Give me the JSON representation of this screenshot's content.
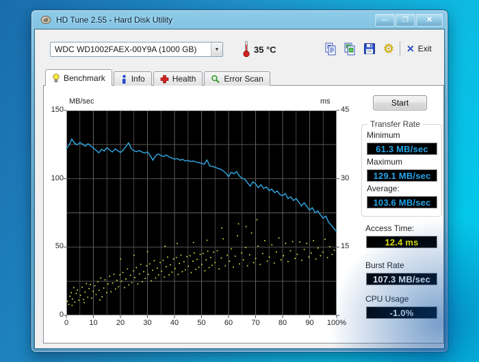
{
  "window": {
    "title": "HD Tune 2.55 - Hard Disk Utility",
    "minimize_glyph": "—",
    "maximize_glyph": "❐",
    "close_glyph": "✕"
  },
  "toolbar": {
    "drive": "WDC WD1002FAEX-00Y9A (1000 GB)",
    "dropdown_arrow": "▼",
    "temperature": "35 °C",
    "options_glyph": "⚙",
    "exit_glyph": "✕",
    "exit_label": "Exit"
  },
  "tabs": [
    {
      "label": "Benchmark",
      "active": true
    },
    {
      "label": "Info",
      "active": false
    },
    {
      "label": "Health",
      "active": false
    },
    {
      "label": "Error Scan",
      "active": false
    }
  ],
  "panel": {
    "start_label": "Start",
    "transfer_rate": {
      "title": "Transfer Rate",
      "minimum_label": "Minimum",
      "minimum_value": "61.3 MB/sec",
      "maximum_label": "Maximum",
      "maximum_value": "129.1 MB/sec",
      "average_label": "Average:",
      "average_value": "103.6 MB/sec"
    },
    "access_time_label": "Access Time:",
    "access_time_value": "12.4 ms",
    "burst_rate_label": "Burst Rate",
    "burst_rate_value": "107.3 MB/sec",
    "cpu_usage_label": "CPU Usage",
    "cpu_usage_value": "-1.0%"
  },
  "colors": {
    "transfer_line": "#2da2da",
    "access_dots": "#d6e23e",
    "value_cyan": "#25a5e8",
    "value_yellow": "#e8e400",
    "grid": "#616161",
    "plot_bg": "#000000"
  },
  "chart_data": {
    "type": "line",
    "title": "HD Tune benchmark: transfer rate line (MB/sec, left axis) with access time scatter (ms, right axis) vs disk position (%)",
    "left_axis": {
      "label": "MB/sec",
      "range": [
        0,
        150
      ],
      "tick_labels": [
        "150",
        "100",
        "50",
        "0"
      ]
    },
    "right_axis": {
      "label": "ms",
      "range": [
        0,
        45
      ],
      "tick_labels": [
        "45",
        "30",
        "15"
      ]
    },
    "x_axis": {
      "range": [
        0,
        100
      ],
      "tick_labels": [
        "0",
        "10",
        "20",
        "30",
        "40",
        "50",
        "60",
        "70",
        "80",
        "90",
        "100%"
      ]
    },
    "grid": {
      "vertical_step_pct": 5,
      "horizontal_step_mbsec": 25
    },
    "series": [
      {
        "name": "transfer_rate",
        "kind": "line",
        "color": "#2da2da",
        "y_unit": "MB/sec",
        "min": 61.3,
        "max": 129.1,
        "average": 103.6,
        "points": [
          [
            0,
            122
          ],
          [
            1,
            124.5
          ],
          [
            2,
            129.1
          ],
          [
            3,
            126
          ],
          [
            4,
            124.8
          ],
          [
            5,
            126.5
          ],
          [
            6,
            125.2
          ],
          [
            7,
            123.8
          ],
          [
            8,
            125.6
          ],
          [
            9,
            124
          ],
          [
            10,
            122.5
          ],
          [
            11,
            120.8
          ],
          [
            12,
            118.9
          ],
          [
            13,
            121.5
          ],
          [
            14,
            120.2
          ],
          [
            15,
            122.8
          ],
          [
            16,
            121
          ],
          [
            17,
            119.5
          ],
          [
            18,
            121.8
          ],
          [
            19,
            120.5
          ],
          [
            20,
            119.2
          ],
          [
            21,
            121
          ],
          [
            22,
            123.5
          ],
          [
            23,
            126.3
          ],
          [
            24,
            122
          ],
          [
            25,
            120.4
          ],
          [
            26,
            119.8
          ],
          [
            27,
            120.6
          ],
          [
            28,
            119.5
          ],
          [
            29,
            118.8
          ],
          [
            30,
            119.6
          ],
          [
            31,
            117
          ],
          [
            32,
            113.5
          ],
          [
            33,
            116.8
          ],
          [
            34,
            118.2
          ],
          [
            35,
            117
          ],
          [
            36,
            116.2
          ],
          [
            37,
            117.4
          ],
          [
            38,
            116
          ],
          [
            39,
            115.2
          ],
          [
            40,
            114.4
          ],
          [
            41,
            114.8
          ],
          [
            42,
            113.6
          ],
          [
            43,
            114.2
          ],
          [
            44,
            113
          ],
          [
            45,
            113.4
          ],
          [
            46,
            112.6
          ],
          [
            47,
            113
          ],
          [
            48,
            112.2
          ],
          [
            49,
            111.8
          ],
          [
            50,
            111.2
          ],
          [
            51,
            110.6
          ],
          [
            52,
            113.8
          ],
          [
            53,
            109.4
          ],
          [
            54,
            109
          ],
          [
            55,
            108.4
          ],
          [
            56,
            107.6
          ],
          [
            57,
            107
          ],
          [
            58,
            105.8
          ],
          [
            59,
            104.2
          ],
          [
            60,
            101.5
          ],
          [
            61,
            104.8
          ],
          [
            62,
            103.6
          ],
          [
            63,
            105.2
          ],
          [
            64,
            102
          ],
          [
            65,
            100.4
          ],
          [
            66,
            99.6
          ],
          [
            67,
            97
          ],
          [
            68,
            94.5
          ],
          [
            69,
            97.8
          ],
          [
            70,
            96.2
          ],
          [
            71,
            93.4
          ],
          [
            72,
            95.6
          ],
          [
            73,
            92.8
          ],
          [
            74,
            94
          ],
          [
            75,
            91.2
          ],
          [
            76,
            92.4
          ],
          [
            77,
            89.8
          ],
          [
            78,
            91
          ],
          [
            79,
            88.4
          ],
          [
            80,
            87.6
          ],
          [
            81,
            89.2
          ],
          [
            82,
            85.4
          ],
          [
            83,
            86.8
          ],
          [
            84,
            84
          ],
          [
            85,
            85.6
          ],
          [
            86,
            82.8
          ],
          [
            87,
            80
          ],
          [
            88,
            82.4
          ],
          [
            89,
            79.6
          ],
          [
            90,
            77
          ],
          [
            91,
            78.8
          ],
          [
            92,
            75.2
          ],
          [
            93,
            76.4
          ],
          [
            94,
            73.6
          ],
          [
            95,
            71
          ],
          [
            96,
            72.8
          ],
          [
            97,
            68.2
          ],
          [
            98,
            66
          ],
          [
            99,
            63.5
          ],
          [
            100,
            61.3
          ]
        ]
      },
      {
        "name": "access_time",
        "kind": "scatter",
        "color": "#d6e23e",
        "y_unit": "ms",
        "average": 12.4,
        "points": [
          [
            0.4,
            3.1
          ],
          [
            0.9,
            2.4
          ],
          [
            1.3,
            4.2
          ],
          [
            1.8,
            5
          ],
          [
            2.2,
            3.6
          ],
          [
            2.7,
            6.1
          ],
          [
            3.1,
            2.9
          ],
          [
            3.6,
            4.8
          ],
          [
            4.1,
            5.6
          ],
          [
            4.6,
            3.3
          ],
          [
            5.2,
            4.4
          ],
          [
            5.8,
            6.2
          ],
          [
            6.3,
            3.5
          ],
          [
            6.9,
            5.1
          ],
          [
            7.4,
            7
          ],
          [
            7.9,
            4
          ],
          [
            8.4,
            5.9
          ],
          [
            8.9,
            6.8
          ],
          [
            9.4,
            3.8
          ],
          [
            9.9,
            5.3
          ],
          [
            10.5,
            6.5
          ],
          [
            11,
            4.6
          ],
          [
            11.6,
            7.4
          ],
          [
            12.1,
            5.5
          ],
          [
            12.7,
            8.2
          ],
          [
            13.2,
            4.1
          ],
          [
            13.8,
            6
          ],
          [
            14.3,
            7.8
          ],
          [
            14.9,
            5
          ],
          [
            15.4,
            6.9
          ],
          [
            16,
            8.6
          ],
          [
            16.5,
            5.2
          ],
          [
            17.1,
            7.1
          ],
          [
            17.6,
            9
          ],
          [
            18.2,
            5.8
          ],
          [
            18.7,
            7.7
          ],
          [
            19.3,
            6.3
          ],
          [
            19.8,
            8.9
          ],
          [
            20.4,
            7.5
          ],
          [
            20.9,
            9.4
          ],
          [
            21.5,
            6.1
          ],
          [
            22,
            8
          ],
          [
            22.6,
            10.2
          ],
          [
            23.1,
            6.7
          ],
          [
            23.7,
            8.8
          ],
          [
            24.2,
            7.2
          ],
          [
            24.8,
            9.8
          ],
          [
            25.3,
            8.3
          ],
          [
            25.9,
            10.5
          ],
          [
            26.4,
            6.9
          ],
          [
            27,
            9.1
          ],
          [
            27.5,
            11.2
          ],
          [
            28.1,
            7.4
          ],
          [
            28.6,
            9.6
          ],
          [
            29.2,
            8.1
          ],
          [
            29.7,
            10.9
          ],
          [
            30.3,
            9
          ],
          [
            30.8,
            11.3
          ],
          [
            31.4,
            7.6
          ],
          [
            31.9,
            9.9
          ],
          [
            32.5,
            12
          ],
          [
            33,
            8.2
          ],
          [
            33.6,
            10.4
          ],
          [
            34.1,
            8.9
          ],
          [
            34.7,
            11.6
          ],
          [
            35.2,
            9.7
          ],
          [
            35.8,
            12.1
          ],
          [
            36.3,
            8.4
          ],
          [
            36.9,
            10.7
          ],
          [
            37.4,
            12.8
          ],
          [
            38,
            8.9
          ],
          [
            38.5,
            11.1
          ],
          [
            39.1,
            9.5
          ],
          [
            39.6,
            12.4
          ],
          [
            40.2,
            10.3
          ],
          [
            40.7,
            12.7
          ],
          [
            41.3,
            9
          ],
          [
            41.8,
            11.4
          ],
          [
            42.4,
            13.2
          ],
          [
            42.9,
            9.6
          ],
          [
            43.5,
            11.8
          ],
          [
            44,
            10
          ],
          [
            44.6,
            12.9
          ],
          [
            45.1,
            10.8
          ],
          [
            45.7,
            13.1
          ],
          [
            46.2,
            9.4
          ],
          [
            46.8,
            11.9
          ],
          [
            47.3,
            13.7
          ],
          [
            47.9,
            10.1
          ],
          [
            48.4,
            12.3
          ],
          [
            49,
            10.6
          ],
          [
            49.5,
            13.4
          ],
          [
            50.1,
            11.2
          ],
          [
            50.6,
            13.6
          ],
          [
            51.2,
            9.8
          ],
          [
            51.7,
            12.2
          ],
          [
            52.3,
            14.1
          ],
          [
            52.8,
            10.5
          ],
          [
            53.4,
            12.7
          ],
          [
            53.9,
            11
          ],
          [
            54.5,
            13.9
          ],
          [
            55,
            11.6
          ],
          [
            55.8,
            14.2
          ],
          [
            56.5,
            10.2
          ],
          [
            57.3,
            12.6
          ],
          [
            58,
            16.8
          ],
          [
            58.8,
            10.9
          ],
          [
            59.5,
            13.2
          ],
          [
            60.3,
            11.9
          ],
          [
            61,
            14.6
          ],
          [
            61.8,
            10.6
          ],
          [
            62.5,
            13
          ],
          [
            63.3,
            17.5
          ],
          [
            64,
            11.3
          ],
          [
            64.8,
            13.7
          ],
          [
            65.5,
            12.2
          ],
          [
            66.3,
            14.9
          ],
          [
            67,
            10.9
          ],
          [
            67.8,
            13.3
          ],
          [
            68.5,
            18.1
          ],
          [
            69.3,
            11.6
          ],
          [
            70,
            12.5
          ],
          [
            70.9,
            15.2
          ],
          [
            71.7,
            11.2
          ],
          [
            72.6,
            13.6
          ],
          [
            73.4,
            16.4
          ],
          [
            74.3,
            11.9
          ],
          [
            75.1,
            12.8
          ],
          [
            76,
            15.5
          ],
          [
            76.9,
            11.5
          ],
          [
            77.7,
            13.9
          ],
          [
            78.6,
            17
          ],
          [
            79.4,
            12.2
          ],
          [
            80.3,
            13.1
          ],
          [
            81.1,
            15.8
          ],
          [
            82,
            11.8
          ],
          [
            82.9,
            14.2
          ],
          [
            83.7,
            16.2
          ],
          [
            84.6,
            12.5
          ],
          [
            85.4,
            13.4
          ],
          [
            86.3,
            16.1
          ],
          [
            87.1,
            12.1
          ],
          [
            88,
            14.5
          ],
          [
            88.9,
            15.8
          ],
          [
            89.7,
            12.8
          ],
          [
            90.6,
            13.7
          ],
          [
            91.4,
            16.4
          ],
          [
            92.3,
            12.4
          ],
          [
            93.1,
            14.8
          ],
          [
            94,
            13.1
          ],
          [
            94.9,
            13.9
          ],
          [
            95.7,
            16.7
          ],
          [
            96.6,
            12.7
          ],
          [
            97.4,
            15.1
          ],
          [
            98.3,
            13.4
          ],
          [
            99.1,
            14.3
          ],
          [
            57.5,
            19.2
          ],
          [
            63.7,
            20.1
          ],
          [
            70.5,
            21
          ],
          [
            66.5,
            19.5
          ],
          [
            41,
            15.8
          ],
          [
            36.5,
            15.2
          ],
          [
            47,
            16
          ],
          [
            52,
            16.5
          ],
          [
            30,
            14
          ],
          [
            25,
            13.2
          ],
          [
            20,
            12.4
          ],
          [
            2.1,
            2.2
          ],
          [
            6.6,
            2.8
          ],
          [
            12.4,
            3.4
          ]
        ]
      }
    ]
  }
}
